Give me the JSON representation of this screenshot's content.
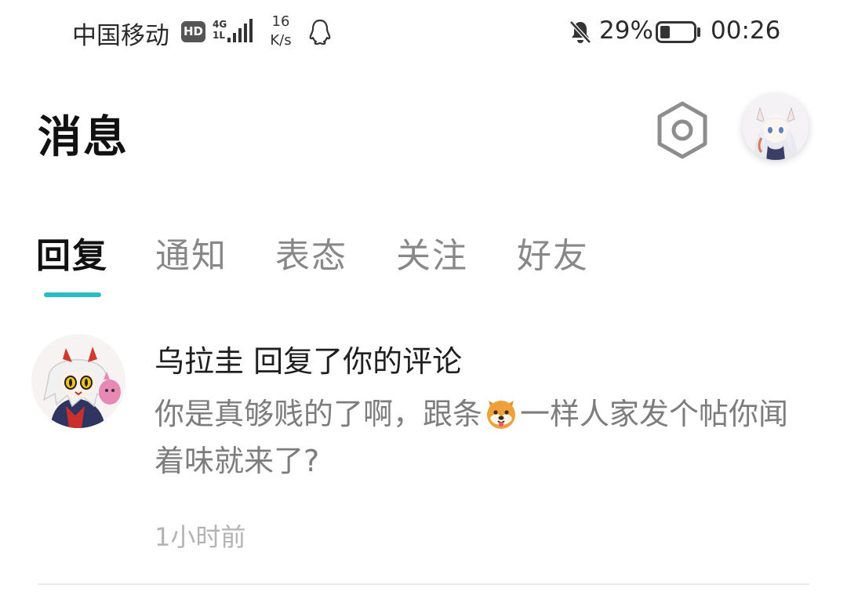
{
  "status_bar": {
    "carrier": "中国移动",
    "hd": "HD",
    "network_top": "4G",
    "network_bottom": "1L",
    "speed_value": "16",
    "speed_unit": "K/s",
    "battery_percent": "29%",
    "battery_level": 0.29,
    "time": "00:26",
    "icons": [
      "hd-badge",
      "signal-icon",
      "qq-icon",
      "bell-muted-icon",
      "battery-icon"
    ]
  },
  "header": {
    "title": "消息",
    "settings_icon": "hexagon-settings-icon",
    "avatar": "user-avatar"
  },
  "tabs": {
    "active_index": 0,
    "items": [
      {
        "label": "回复"
      },
      {
        "label": "通知"
      },
      {
        "label": "表态"
      },
      {
        "label": "关注"
      },
      {
        "label": "好友"
      }
    ],
    "accent_color": "#2bbcc3"
  },
  "messages": [
    {
      "title": "乌拉圭 回复了你的评论",
      "content_before_emoji": "你是真够贱的了啊，跟条",
      "emoji": "dog-face-emoji",
      "content_after_emoji": "一样人家发个帖你闻着味就来了?",
      "time": "1小时前"
    }
  ]
}
